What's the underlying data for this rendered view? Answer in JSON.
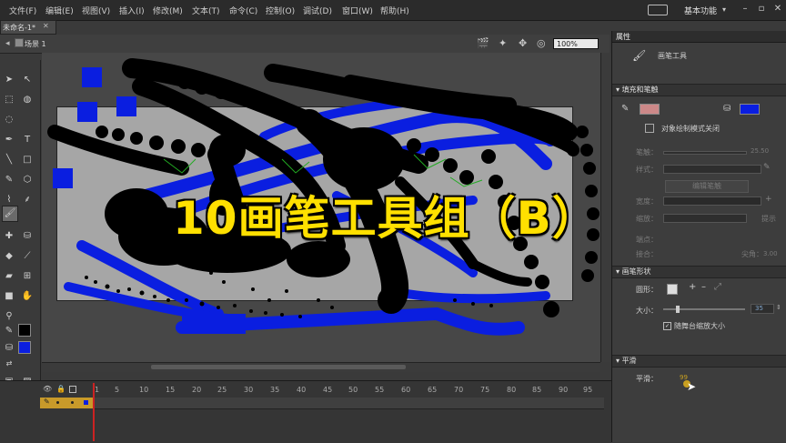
{
  "menu": [
    "文件(F)",
    "编辑(E)",
    "视图(V)",
    "插入(I)",
    "修改(M)",
    "文本(T)",
    "命令(C)",
    "控制(O)",
    "调试(D)",
    "窗口(W)",
    "帮助(H)"
  ],
  "workspace": "基本功能",
  "doc_tab": "未命名-1*",
  "scene": "场景 1",
  "zoom": "100%",
  "overlay_title": "10画笔工具组（B）",
  "properties": {
    "tab": "属性",
    "tool_name": "画笔工具",
    "section_fill_stroke": "填充和笔触",
    "object_draw": "对象绘制模式关闭",
    "stroke_label": "笔触：",
    "stroke_value": "25.50",
    "style_label": "样式：",
    "edit_brush_btn": "编辑笔触",
    "width_label": "宽度：",
    "scale_label": "缩放：",
    "hint_label": "提示",
    "cap_label": "端点：",
    "join_label": "接合：",
    "miter_label": "尖角：",
    "miter_value": "3.00",
    "section_brush_shape": "画笔形状",
    "shape_label": "圆形：",
    "size_label": "大小：",
    "size_value": "35",
    "scale_with_stage": "随舞台缩放大小",
    "section_smooth": "平滑",
    "smooth_label": "平滑：",
    "smooth_value": "99",
    "colors": {
      "fill": "#0a1ee0",
      "stroke": "#000000"
    }
  },
  "timeline": {
    "frames": [
      "1",
      "5",
      "10",
      "15",
      "20",
      "25",
      "30",
      "35",
      "40",
      "45",
      "50",
      "55",
      "60",
      "65",
      "70",
      "75",
      "80",
      "85",
      "90",
      "95"
    ]
  }
}
